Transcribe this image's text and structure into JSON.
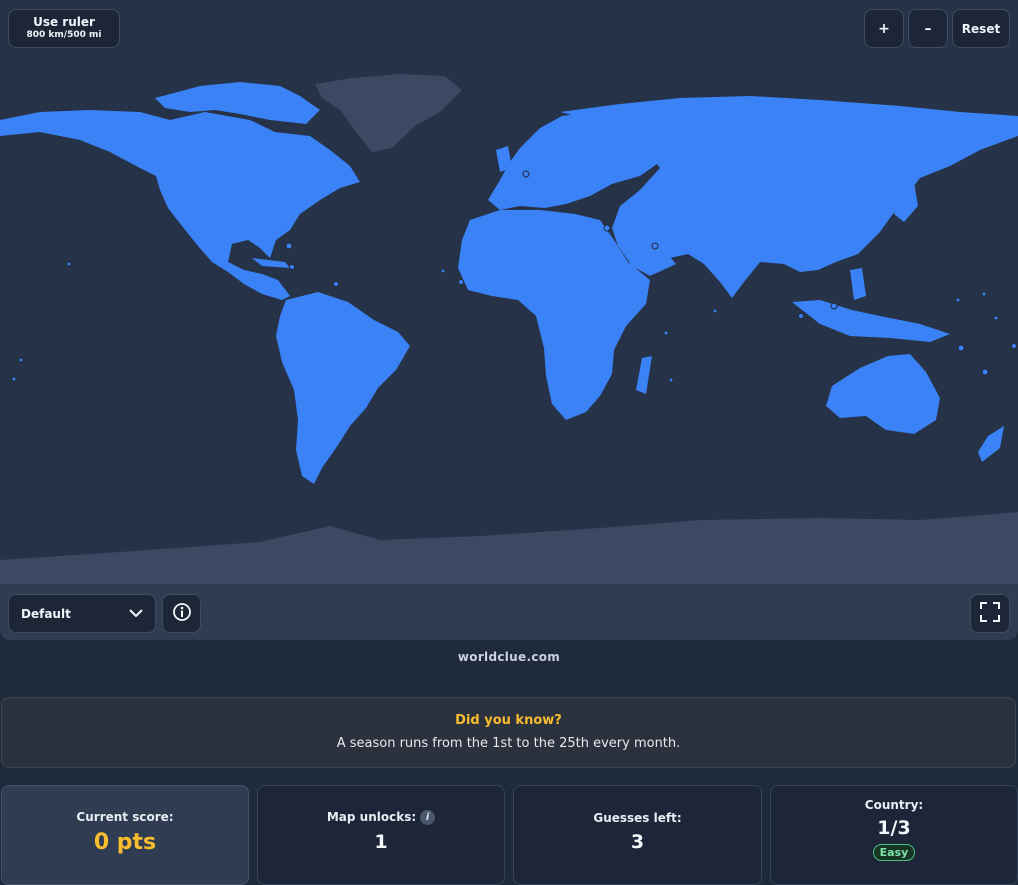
{
  "map": {
    "ruler_title": "Use ruler",
    "ruler_sub": "800 km/500 mi",
    "zoom_in": "+",
    "zoom_out": "–",
    "reset": "Reset",
    "layer_value": "Default",
    "icons": {
      "chevron": "chevron-down-icon",
      "info": "info-icon",
      "fullscreen": "fullscreen-icon"
    }
  },
  "brand": "worldclue.com",
  "fact": {
    "title": "Did you know?",
    "text": "A season runs from the 1st to the 25th every month."
  },
  "stats": {
    "score_label": "Current score:",
    "score_value": "0 pts",
    "unlocks_label": "Map unlocks:",
    "unlocks_value": "1",
    "guesses_label": "Guesses left:",
    "guesses_value": "3",
    "country_label": "Country:",
    "country_value": "1/3",
    "difficulty": "Easy"
  },
  "colors": {
    "land": "#3b82f6",
    "ocean": "#253247",
    "accent": "#f7bd2e",
    "easy": "#7ce2a8"
  }
}
